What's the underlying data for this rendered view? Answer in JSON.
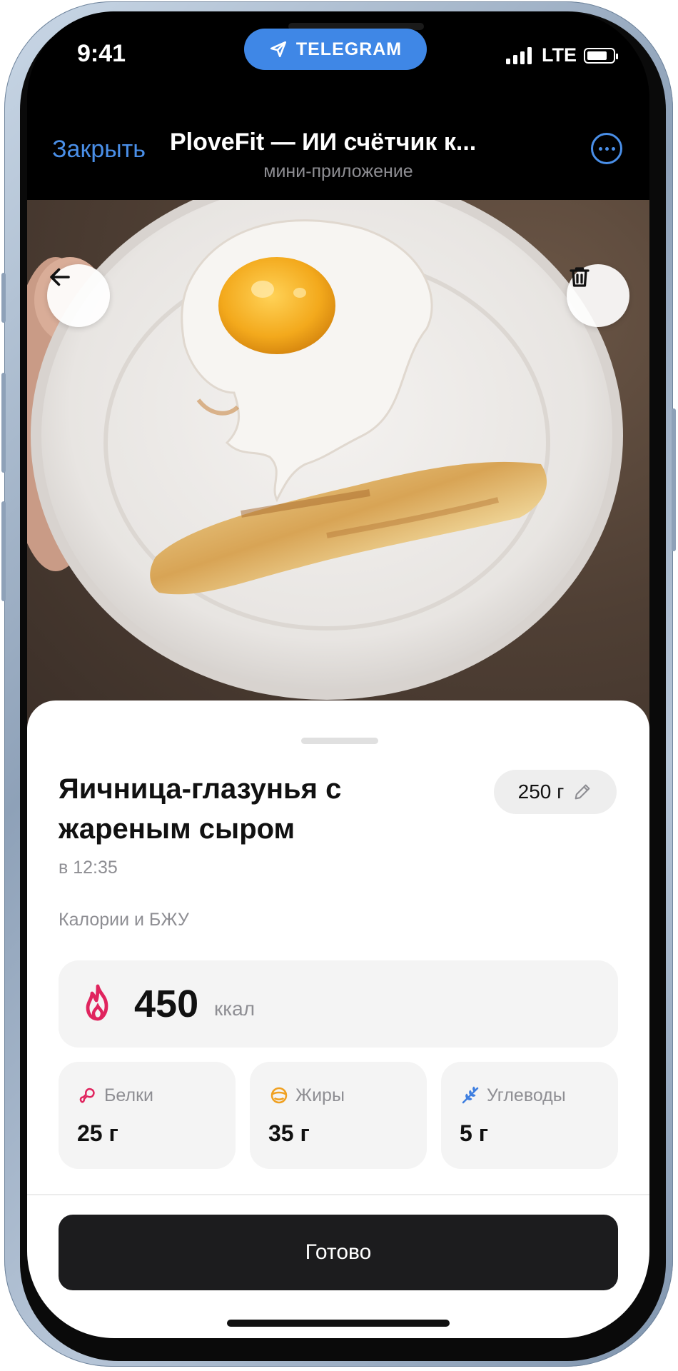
{
  "status_bar": {
    "time": "9:41",
    "pill_label": "TELEGRAM",
    "network": "LTE",
    "battery_level": 0.8
  },
  "header": {
    "close_label": "Закрыть",
    "title": "PloveFit — ИИ счётчик к...",
    "subtitle": "мини-приложение"
  },
  "photo": {
    "back_icon": "arrow-left-icon",
    "delete_icon": "trash-icon"
  },
  "meal": {
    "title": "Яичница-глазунья с жареным сыром",
    "time": "в 12:35",
    "weight": "250 г",
    "weight_edit_icon": "pencil-icon",
    "section_label": "Калории и БЖУ",
    "calories": {
      "value": "450",
      "unit": "ккал",
      "icon": "flame-icon",
      "icon_color": "#e0245e"
    },
    "macros": [
      {
        "label": "Белки",
        "value": "25 г",
        "icon": "protein-icon",
        "color": "#e0245e"
      },
      {
        "label": "Жиры",
        "value": "35 г",
        "icon": "fat-icon",
        "color": "#f0a020"
      },
      {
        "label": "Углеводы",
        "value": "5 г",
        "icon": "wheat-icon",
        "color": "#3f7fe0"
      }
    ]
  },
  "actions": {
    "done_label": "Готово"
  },
  "colors": {
    "accent": "#4a8fe8",
    "telegram_pill": "#3f87e6",
    "button_dark": "#1c1c1e"
  }
}
